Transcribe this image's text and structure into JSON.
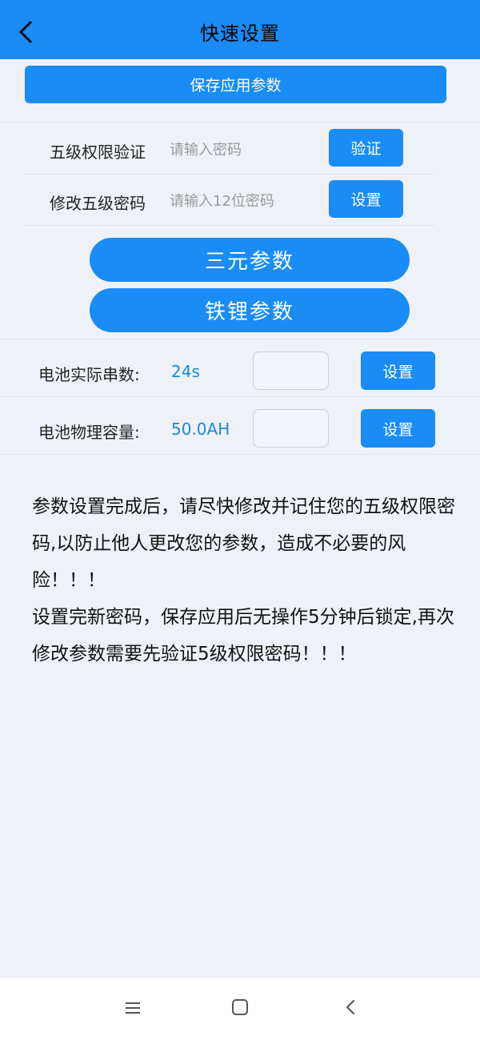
{
  "header": {
    "title": "快速设置",
    "back_icon": "chevron-left-icon"
  },
  "save_button": {
    "label": "保存应用参数"
  },
  "auth": {
    "verify_label": "五级权限验证",
    "verify_placeholder": "请输入密码",
    "verify_button": "验证",
    "change_label": "修改五级密码",
    "change_placeholder": "请输入12位密码",
    "change_button": "设置"
  },
  "presets": {
    "ternary": "三元参数",
    "lifepo4": "铁锂参数"
  },
  "battery": {
    "series_label": "电池实际串数:",
    "series_value": "24s",
    "series_button": "设置",
    "capacity_label": "电池物理容量:",
    "capacity_value": "50.0AH",
    "capacity_button": "设置"
  },
  "notice": {
    "para1": "参数设置完成后，请尽快修改并记住您的五级权限密码,以防止他人更改您的参数，造成不必要的风险！！！",
    "para2": "设置完新密码，保存应用后无操作5分钟后锁定,再次修改参数需要先验证5级权限密码！！！"
  },
  "navbar": {
    "menu_icon": "menu-icon",
    "home_icon": "square-home-icon",
    "back_icon": "back-triangle-icon"
  },
  "colors": {
    "accent": "#1a8cf5",
    "value": "#1e88d8",
    "background": "#eef2f8"
  }
}
